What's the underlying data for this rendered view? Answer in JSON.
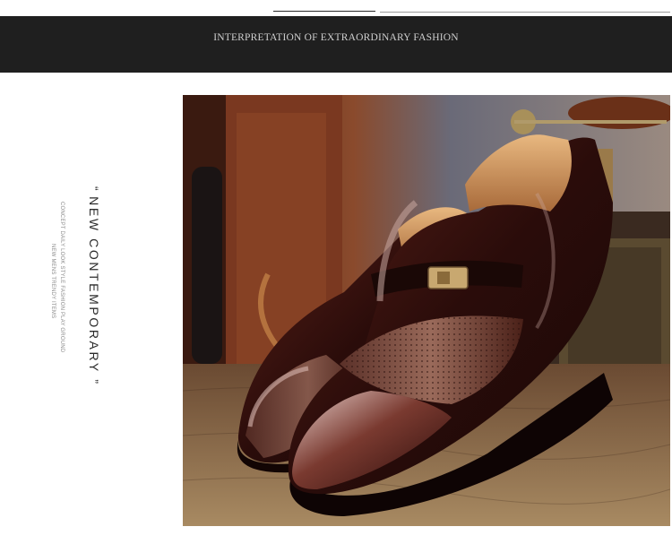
{
  "banner": {
    "title": "INTERPRETATION OF EXTRAORDINARY FASHION"
  },
  "side_text": {
    "quote_open": "“",
    "headline": "NEW CONTEMPORARY",
    "quote_close": "”",
    "tagline_line1": "CONCEPT DAILY LOOK STYLE FASHION PLAY GROUND",
    "tagline_line2": "NEW MENS TRENDY ITEMS"
  },
  "photo": {
    "subject": "brown patent leather slip-on dress shoes with perforated panel and metal buckle strap",
    "colors": {
      "leather": "#3a1410",
      "leather_highlight": "#c9a7a0",
      "perforated_panel": "#7a4a3c",
      "lining": "#d8a870",
      "floor": "#8a6a4a",
      "background_wood": "#7a3a22"
    }
  }
}
